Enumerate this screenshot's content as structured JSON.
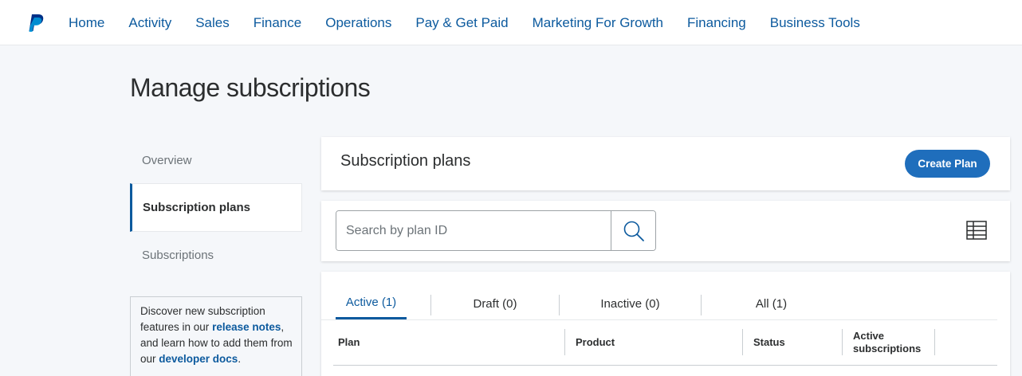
{
  "nav": {
    "logo": "paypal-logo",
    "links": [
      "Home",
      "Activity",
      "Sales",
      "Finance",
      "Operations",
      "Pay & Get Paid",
      "Marketing For Growth",
      "Financing",
      "Business Tools"
    ]
  },
  "page": {
    "title": "Manage subscriptions"
  },
  "sidebar": {
    "items": [
      {
        "label": "Overview"
      },
      {
        "label": "Subscription plans"
      },
      {
        "label": "Subscriptions"
      }
    ],
    "info": {
      "text1": "Discover new subscription features in our ",
      "link1": "release notes",
      "text2": ", and learn how to add them from our ",
      "link2": "developer docs",
      "text3": "."
    }
  },
  "plans": {
    "title": "Subscription plans",
    "create_label": "Create Plan"
  },
  "search": {
    "placeholder": "Search by plan ID",
    "value": ""
  },
  "tabs": [
    {
      "label": "Active (1)"
    },
    {
      "label": "Draft (0)"
    },
    {
      "label": "Inactive (0)"
    },
    {
      "label": "All (1)"
    }
  ],
  "table": {
    "columns": [
      "Plan",
      "Product",
      "Status",
      "Active subscriptions"
    ]
  },
  "colors": {
    "primary": "#0c5a9e",
    "button": "#1f6ebc",
    "background": "#f5f7fa"
  }
}
